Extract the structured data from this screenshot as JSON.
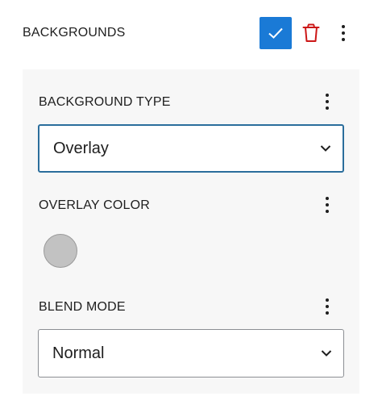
{
  "header": {
    "title": "BACKGROUNDS",
    "confirm_icon": "check-icon",
    "delete_icon": "trash-icon",
    "more_icon": "more-vertical-icon",
    "accent_color": "#1a7ad6",
    "delete_color": "#cc1818"
  },
  "panel": {
    "background_type": {
      "label": "BACKGROUND TYPE",
      "value": "Overlay"
    },
    "overlay_color": {
      "label": "OVERLAY COLOR",
      "swatch_color": "#c2c2c2"
    },
    "blend_mode": {
      "label": "BLEND MODE",
      "value": "Normal"
    }
  }
}
